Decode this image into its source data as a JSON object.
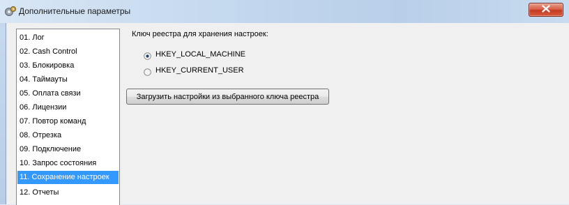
{
  "window": {
    "title": "Дополнительные параметры",
    "icon": "settings-gear-icon",
    "close_icon": "close-x-icon"
  },
  "sidebar": {
    "items": [
      {
        "label": "01. Лог",
        "selected": false
      },
      {
        "label": "02. Cash Control",
        "selected": false
      },
      {
        "label": "03. Блокировка",
        "selected": false
      },
      {
        "label": "04. Таймауты",
        "selected": false
      },
      {
        "label": "05. Оплата связи",
        "selected": false
      },
      {
        "label": "06. Лицензии",
        "selected": false
      },
      {
        "label": "07. Повтор команд",
        "selected": false
      },
      {
        "label": "08. Отрезка",
        "selected": false
      },
      {
        "label": "09. Подключение",
        "selected": false
      },
      {
        "label": "10. Запрос состояния",
        "selected": false
      },
      {
        "label": "11. Сохранение настроек",
        "selected": true
      },
      {
        "label": "12. Отчеты",
        "selected": false
      }
    ]
  },
  "main": {
    "group_label": "Ключ реестра для хранения настроек:",
    "options": [
      {
        "label": "HKEY_LOCAL_MACHINE",
        "checked": true
      },
      {
        "label": "HKEY_CURRENT_USER",
        "checked": false
      }
    ],
    "load_button": "Загрузить настройки из выбранного ключа реестра"
  },
  "colors": {
    "selection": "#3399ff",
    "close_button": "#c9462c"
  }
}
